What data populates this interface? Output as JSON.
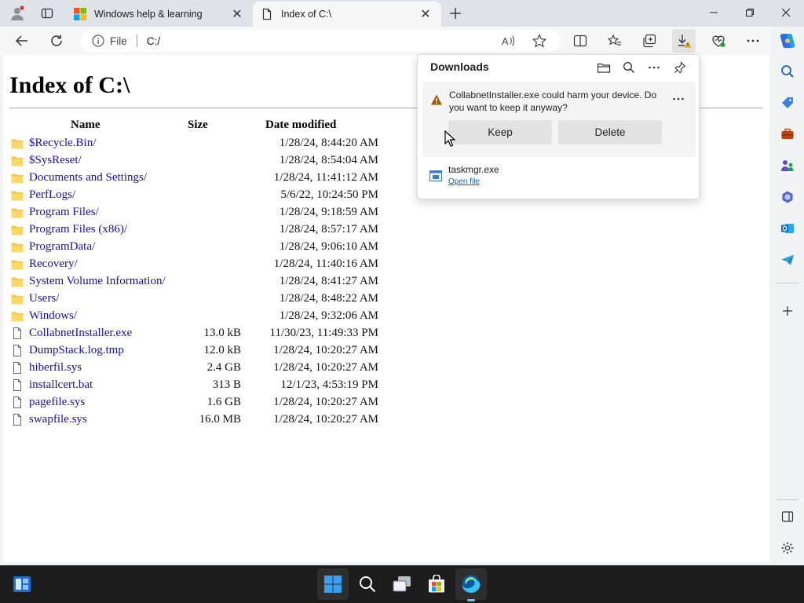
{
  "browser": {
    "tabs": [
      {
        "title": "Windows help & learning",
        "active": false,
        "icon": "microsoft-logo-icon"
      },
      {
        "title": "Index of C:\\",
        "active": true,
        "icon": "page-icon"
      }
    ],
    "address": {
      "scheme": "File",
      "url": "C:/"
    },
    "accent_color": "#0a5fb4"
  },
  "page": {
    "heading": "Index of C:\\",
    "columns": {
      "name": "Name",
      "size": "Size",
      "date": "Date modified"
    },
    "entries": [
      {
        "name": "$Recycle.Bin/",
        "size": "",
        "date": "1/28/24, 8:44:20 AM",
        "type": "folder"
      },
      {
        "name": "$SysReset/",
        "size": "",
        "date": "1/28/24, 8:54:04 AM",
        "type": "folder"
      },
      {
        "name": "Documents and Settings/",
        "size": "",
        "date": "1/28/24, 11:41:12 AM",
        "type": "folder"
      },
      {
        "name": "PerfLogs/",
        "size": "",
        "date": "5/6/22, 10:24:50 PM",
        "type": "folder"
      },
      {
        "name": "Program Files/",
        "size": "",
        "date": "1/28/24, 9:18:59 AM",
        "type": "folder"
      },
      {
        "name": "Program Files (x86)/",
        "size": "",
        "date": "1/28/24, 8:57:17 AM",
        "type": "folder"
      },
      {
        "name": "ProgramData/",
        "size": "",
        "date": "1/28/24, 9:06:10 AM",
        "type": "folder"
      },
      {
        "name": "Recovery/",
        "size": "",
        "date": "1/28/24, 11:40:16 AM",
        "type": "folder"
      },
      {
        "name": "System Volume Information/",
        "size": "",
        "date": "1/28/24, 8:41:27 AM",
        "type": "folder"
      },
      {
        "name": "Users/",
        "size": "",
        "date": "1/28/24, 8:48:22 AM",
        "type": "folder"
      },
      {
        "name": "Windows/",
        "size": "",
        "date": "1/28/24, 9:32:06 AM",
        "type": "folder"
      },
      {
        "name": "CollabnetInstaller.exe",
        "size": "13.0 kB",
        "date": "11/30/23, 11:49:33 PM",
        "type": "file"
      },
      {
        "name": "DumpStack.log.tmp",
        "size": "12.0 kB",
        "date": "1/28/24, 10:20:27 AM",
        "type": "file"
      },
      {
        "name": "hiberfil.sys",
        "size": "2.4 GB",
        "date": "1/28/24, 10:20:27 AM",
        "type": "file"
      },
      {
        "name": "installcert.bat",
        "size": "313 B",
        "date": "12/1/23, 4:53:19 PM",
        "type": "file"
      },
      {
        "name": "pagefile.sys",
        "size": "1.6 GB",
        "date": "1/28/24, 10:20:27 AM",
        "type": "file"
      },
      {
        "name": "swapfile.sys",
        "size": "16.0 MB",
        "date": "1/28/24, 10:20:27 AM",
        "type": "file"
      }
    ]
  },
  "downloads": {
    "title": "Downloads",
    "warning": {
      "message": "CollabnetInstaller.exe could harm your device. Do you want to keep it anyway?",
      "keep_label": "Keep",
      "delete_label": "Delete"
    },
    "items": [
      {
        "filename": "taskmgr.exe",
        "action": "Open file"
      }
    ]
  }
}
